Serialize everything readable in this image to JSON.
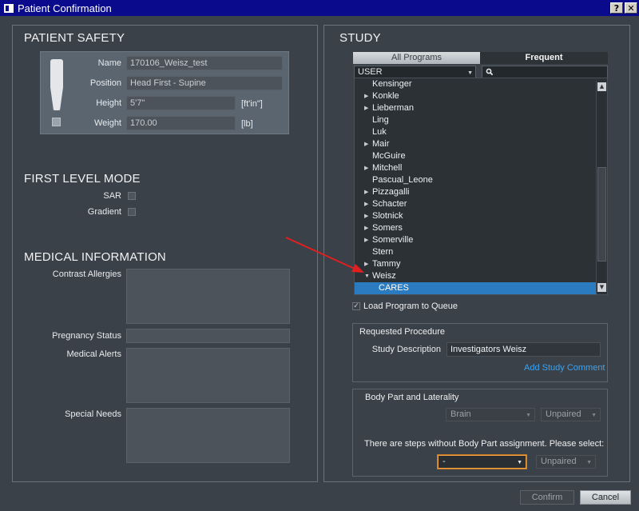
{
  "window": {
    "title": "Patient Confirmation",
    "help_label": "?",
    "close_label": "✕"
  },
  "patient_safety": {
    "title": "PATIENT SAFETY",
    "name_label": "Name",
    "name_value": "170106_Weisz_test",
    "position_label": "Position",
    "position_value": "Head First - Supine",
    "height_label": "Height",
    "height_value": "5'7\"",
    "height_unit": "[ft'in\"]",
    "weight_label": "Weight",
    "weight_value": "170.00",
    "weight_unit": "[lb]"
  },
  "first_level_mode": {
    "title": "FIRST LEVEL MODE",
    "sar_label": "SAR",
    "gradient_label": "Gradient"
  },
  "medical_information": {
    "title": "MEDICAL INFORMATION",
    "contrast_allergies_label": "Contrast Allergies",
    "pregnancy_status_label": "Pregnancy Status",
    "medical_alerts_label": "Medical Alerts",
    "special_needs_label": "Special Needs"
  },
  "study": {
    "title": "STUDY",
    "tabs": [
      {
        "label": "All Programs"
      },
      {
        "label": "Frequent"
      }
    ],
    "user_select": "USER",
    "list": [
      {
        "label": "Kensinger",
        "expandable": false
      },
      {
        "label": "Konkle",
        "expandable": true
      },
      {
        "label": "Lieberman",
        "expandable": true
      },
      {
        "label": "Ling",
        "expandable": false
      },
      {
        "label": "Luk",
        "expandable": false
      },
      {
        "label": "Mair",
        "expandable": true
      },
      {
        "label": "McGuire",
        "expandable": false
      },
      {
        "label": "Mitchell",
        "expandable": true
      },
      {
        "label": "Pascual_Leone",
        "expandable": false
      },
      {
        "label": "Pizzagalli",
        "expandable": true
      },
      {
        "label": "Schacter",
        "expandable": true
      },
      {
        "label": "Slotnick",
        "expandable": true
      },
      {
        "label": "Somers",
        "expandable": true
      },
      {
        "label": "Somerville",
        "expandable": true
      },
      {
        "label": "Stern",
        "expandable": false
      },
      {
        "label": "Tammy",
        "expandable": true
      },
      {
        "label": "Weisz",
        "expandable": true,
        "expanded": true
      },
      {
        "label": "CARES",
        "child": true,
        "selected": true
      }
    ],
    "load_program_label": "Load Program to Queue",
    "load_program_checked": true
  },
  "requested_procedure": {
    "title": "Requested Procedure",
    "study_description_label": "Study Description",
    "study_description_value": "Investigators Weisz",
    "add_comment_link": "Add Study Comment"
  },
  "body_part": {
    "title": "Body Part and Laterality",
    "body_part_value": "Brain",
    "laterality_value": "Unpaired",
    "steps_message": "There are steps without Body Part assignment. Please select:",
    "step_body_part_value": "-",
    "step_laterality_value": "Unpaired"
  },
  "buttons": {
    "confirm_label": "Confirm",
    "cancel_label": "Cancel"
  },
  "colors": {
    "accent": "#2b7bc1",
    "link": "#3da3f0",
    "annotation_arrow": "#e02020",
    "focus": "#f0a040"
  }
}
